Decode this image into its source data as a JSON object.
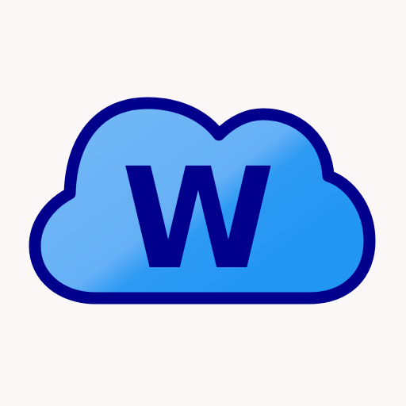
{
  "app_icon": {
    "icon_name": "cloud-letter-w-icon",
    "letter": "W",
    "colors": {
      "background": "#fbf7f6",
      "cloud_fill_light": "#6fb6f6",
      "cloud_fill_dark": "#2196f3",
      "outline": "#01008c",
      "letter": "#01008c"
    }
  }
}
